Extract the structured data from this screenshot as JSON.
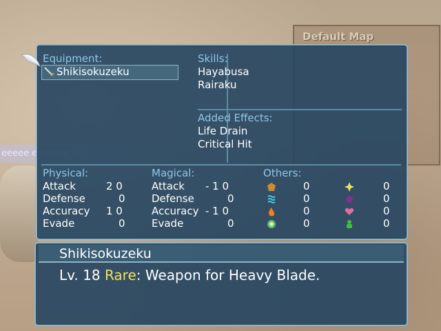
{
  "background": {
    "default_map_label": "Default Map",
    "chat_text": "eeeee eeeeeet :D)"
  },
  "equipment": {
    "label": "Equipment:",
    "item": "Shikisokuzeku"
  },
  "skills": {
    "label": "Skills:",
    "items": [
      "Hayabusa",
      "Rairaku"
    ]
  },
  "added_effects": {
    "label": "Added Effects:",
    "items": [
      "Life Drain",
      "Critical Hit"
    ]
  },
  "physical": {
    "label": "Physical:",
    "stats": [
      {
        "name": "Attack",
        "value": "2 0"
      },
      {
        "name": "Defense",
        "value": "0"
      },
      {
        "name": "Accuracy",
        "value": "1 0"
      },
      {
        "name": "Evade",
        "value": "0"
      }
    ]
  },
  "magical": {
    "label": "Magical:",
    "stats": [
      {
        "name": "Attack",
        "value": "- 1 0"
      },
      {
        "name": "Defense",
        "value": "0"
      },
      {
        "name": "Accuracy",
        "value": "- 1 0"
      },
      {
        "name": "Evade",
        "value": "0"
      }
    ]
  },
  "others": {
    "label": "Others:",
    "left": [
      {
        "icon": "earth-element-icon",
        "value": "0"
      },
      {
        "icon": "water-element-icon",
        "value": "0"
      },
      {
        "icon": "fire-element-icon",
        "value": "0"
      },
      {
        "icon": "wind-element-icon",
        "value": "0"
      }
    ],
    "right": [
      {
        "icon": "light-element-icon",
        "value": "0"
      },
      {
        "icon": "dark-element-icon",
        "value": "0"
      },
      {
        "icon": "heart-status-icon",
        "value": "0"
      },
      {
        "icon": "poison-status-icon",
        "value": "0"
      }
    ]
  },
  "description": {
    "title": "Shikisokuzeku",
    "level": "Lv. 18",
    "rarity": "Rare",
    "rest": ": Weapon for Heavy Blade."
  },
  "colors": {
    "panel_bg": "#284862",
    "label": "#8fc6e8",
    "rare": "#f4e05a"
  }
}
